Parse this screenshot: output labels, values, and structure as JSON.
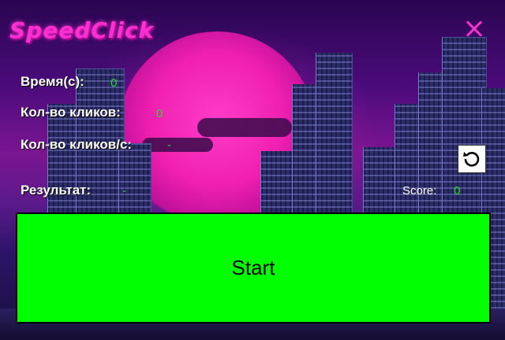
{
  "app": {
    "title": "SpeedClick"
  },
  "stats": {
    "time_label": "Время(с):",
    "time_value": "0",
    "clicks_label": "Кол-во кликов:",
    "clicks_value": "0",
    "cps_label": "Кол-во кликов/с:",
    "cps_value": "-",
    "result_label": "Результат:",
    "result_value": "-",
    "score_label": "Score:",
    "score_value": "0"
  },
  "controls": {
    "start_label": "Start",
    "reset_icon": "reset-icon",
    "close_icon": "close-icon"
  },
  "colors": {
    "accent": "#ff2fd0",
    "value_green": "#2bd92b",
    "start_bg": "#00ff00"
  }
}
